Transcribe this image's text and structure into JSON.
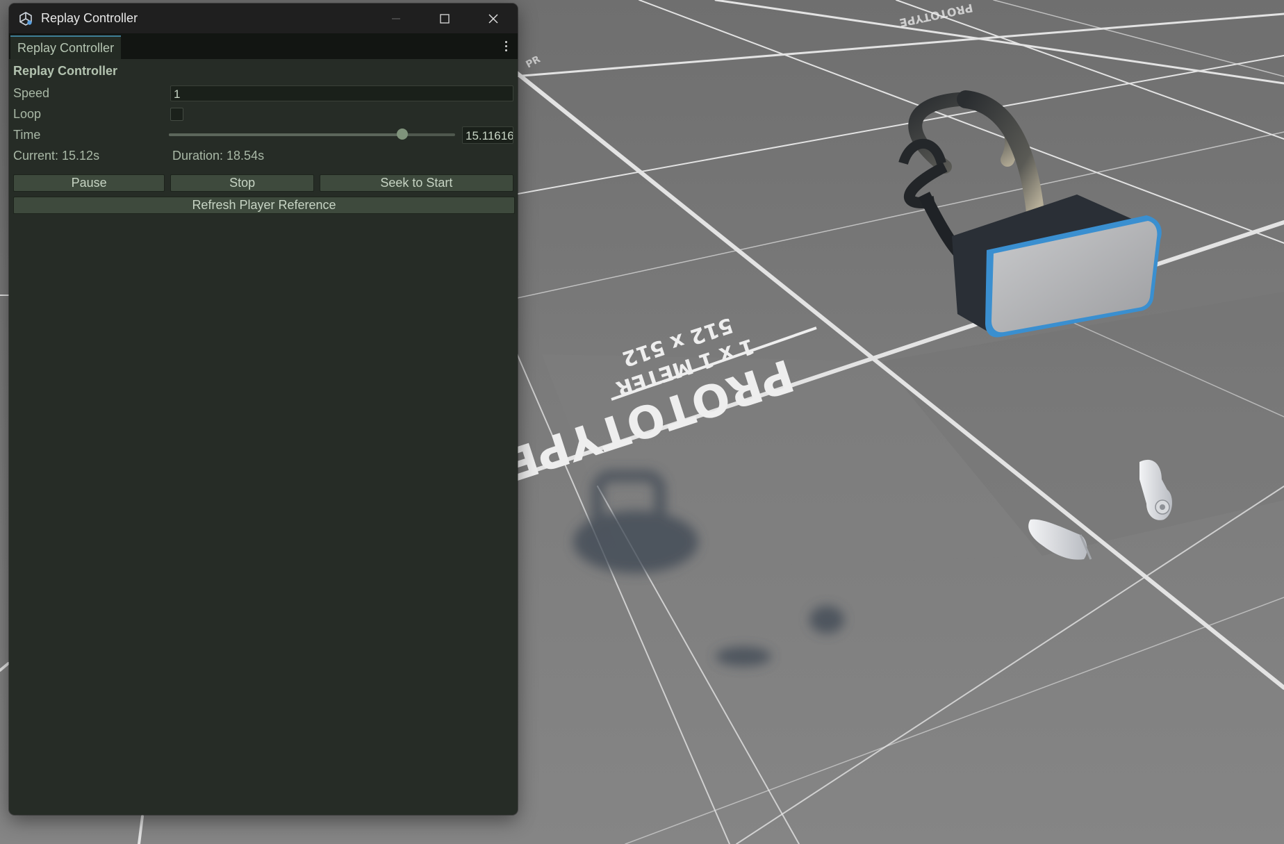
{
  "window": {
    "title": "Replay Controller",
    "controls": {
      "minimize": "minimize-icon",
      "maximize": "maximize-icon",
      "close": "close-icon"
    }
  },
  "tab": {
    "label": "Replay Controller"
  },
  "panel": {
    "header": "Replay Controller",
    "speed": {
      "label": "Speed",
      "value": "1"
    },
    "loop": {
      "label": "Loop",
      "checked": false
    },
    "time": {
      "label": "Time",
      "value": "15.11616",
      "fraction": 0.815
    },
    "current": "Current: 15.12s",
    "duration": "Duration: 18.54s",
    "buttons": {
      "pause": "Pause",
      "stop": "Stop",
      "seek": "Seek to Start",
      "refresh": "Refresh Player Reference"
    }
  },
  "scene": {
    "floor_texture_text": {
      "line1": "PROTOTYPE",
      "line2": "1 x 1 METER",
      "line3": "512 x 512"
    },
    "objects": [
      "vr-headset",
      "left-controller",
      "right-controller"
    ],
    "colors": {
      "floor": "#7b7b7b",
      "grid": "#e6e6e6",
      "headset_trim": "#3a8fd0"
    }
  }
}
